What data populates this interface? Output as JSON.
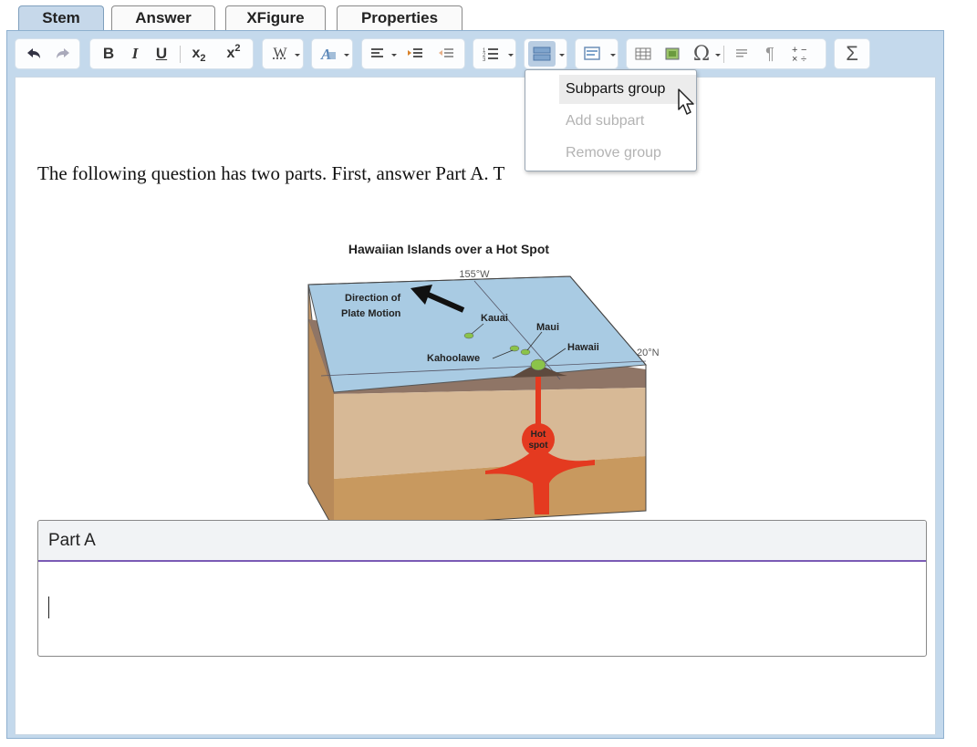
{
  "tabs": [
    {
      "label": "Stem",
      "active": true
    },
    {
      "label": "Answer",
      "active": false
    },
    {
      "label": "XFigure",
      "active": false
    },
    {
      "label": "Properties",
      "active": false
    }
  ],
  "toolbar": {
    "icons": [
      "undo-icon",
      "redo-icon",
      "bold-icon",
      "italic-icon",
      "underline-icon",
      "subscript-icon",
      "superscript-icon",
      "word-style-icon",
      "font-color-icon",
      "align-icon",
      "indent-icon",
      "outdent-icon",
      "numbered-list-icon",
      "subparts-icon",
      "insert-template-icon",
      "table-icon",
      "image-icon",
      "special-char-icon",
      "paragraph-style-icon",
      "pilcrow-icon",
      "math-operators-icon",
      "sigma-icon"
    ],
    "bold": "B",
    "italic": "I",
    "underline": "U",
    "subscript": "x",
    "subscript_mark": "2",
    "superscript": "x",
    "superscript_mark": "2",
    "word_style": "W",
    "omega": "Ω",
    "pilcrow": "¶",
    "sigma": "Σ"
  },
  "stem_text": "The following question has two parts. First, answer Part A. T",
  "figure": {
    "title": "Hawaiian Islands over a Hot Spot",
    "longitude": "155°W",
    "latitude": "20°N",
    "motion_label_1": "Direction of",
    "motion_label_2": "Plate Motion",
    "islands": [
      "Kauai",
      "Maui",
      "Kahoolawe",
      "Hawaii"
    ],
    "hotspot_1": "Hot",
    "hotspot_2": "spot"
  },
  "part_a": {
    "title": "Part A",
    "body": ""
  },
  "dropdown": {
    "items": [
      {
        "label": "Subparts group",
        "enabled": true
      },
      {
        "label": "Add subpart",
        "enabled": false
      },
      {
        "label": "Remove group",
        "enabled": false
      }
    ]
  },
  "colors": {
    "toolbar_bg": "#c4d9ec",
    "active_tab": "#c6d8ea",
    "part_divider": "#7b5bb5",
    "hotspot": "#e43a20",
    "sea": "#a9cbe3"
  }
}
